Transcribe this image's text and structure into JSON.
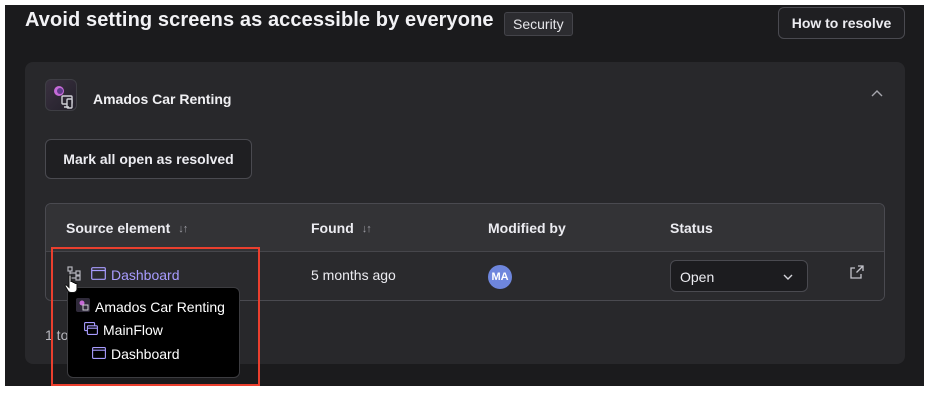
{
  "header": {
    "title": "Avoid setting screens as accessible by everyone",
    "tag": "Security",
    "resolve_button": "How to resolve"
  },
  "app": {
    "name": "Amados Car Renting",
    "mark_button": "Mark all open as resolved",
    "collapse_icon": "chevron-up-icon"
  },
  "table": {
    "columns": [
      "Source element",
      "Found",
      "Modified by",
      "Status"
    ],
    "row": {
      "source": "Dashboard",
      "found": "5 months ago",
      "modified_by": "MA",
      "status": "Open"
    }
  },
  "pager": {
    "text": "1 to"
  },
  "popover": {
    "items": [
      "Amados Car Renting",
      "MainFlow",
      "Dashboard"
    ]
  },
  "colors": {
    "accent_link": "#a89cff",
    "avatar": "#6e86dd",
    "highlight": "#ea3f2e"
  }
}
